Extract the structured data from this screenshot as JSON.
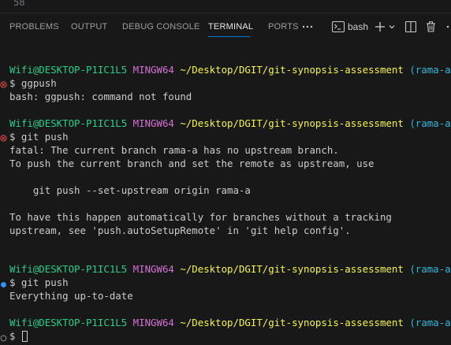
{
  "editor": {
    "line_number": "58"
  },
  "panel": {
    "tabs": [
      {
        "label": "PROBLEMS"
      },
      {
        "label": "OUTPUT"
      },
      {
        "label": "DEBUG CONSOLE"
      },
      {
        "label": "TERMINAL"
      },
      {
        "label": "PORTS"
      }
    ],
    "active_tab": "TERMINAL",
    "shell_label": "bash",
    "accent_color": "#0078d4"
  },
  "terminal": {
    "prompt": {
      "user_host": "Wifi@DESKTOP-P1IC1L5",
      "env": "MINGW64",
      "path": "~/Desktop/DGIT/git-synopsis-assessment",
      "branch": "(rama-a)"
    },
    "colors": {
      "user": "#23d18b",
      "env": "#d670d6",
      "path": "#f5f543",
      "branch": "#29b8db",
      "error_marker": "#f14c4c",
      "success_marker": "#3794ff"
    },
    "commands": [
      {
        "input": "$ ggpush",
        "status": "error",
        "output": [
          "bash: ggpush: command not found"
        ]
      },
      {
        "input": "$ git push",
        "status": "error",
        "output": [
          "fatal: The current branch rama-a has no upstream branch.",
          "To push the current branch and set the remote as upstream, use",
          "",
          "    git push --set-upstream origin rama-a",
          "",
          "To have this happen automatically for branches without a tracking",
          "upstream, see 'push.autoSetupRemote' in 'git help config'."
        ]
      },
      {
        "input": "$ git push",
        "status": "success",
        "output": [
          "Everything up-to-date"
        ]
      }
    ],
    "current_input": "$ "
  }
}
